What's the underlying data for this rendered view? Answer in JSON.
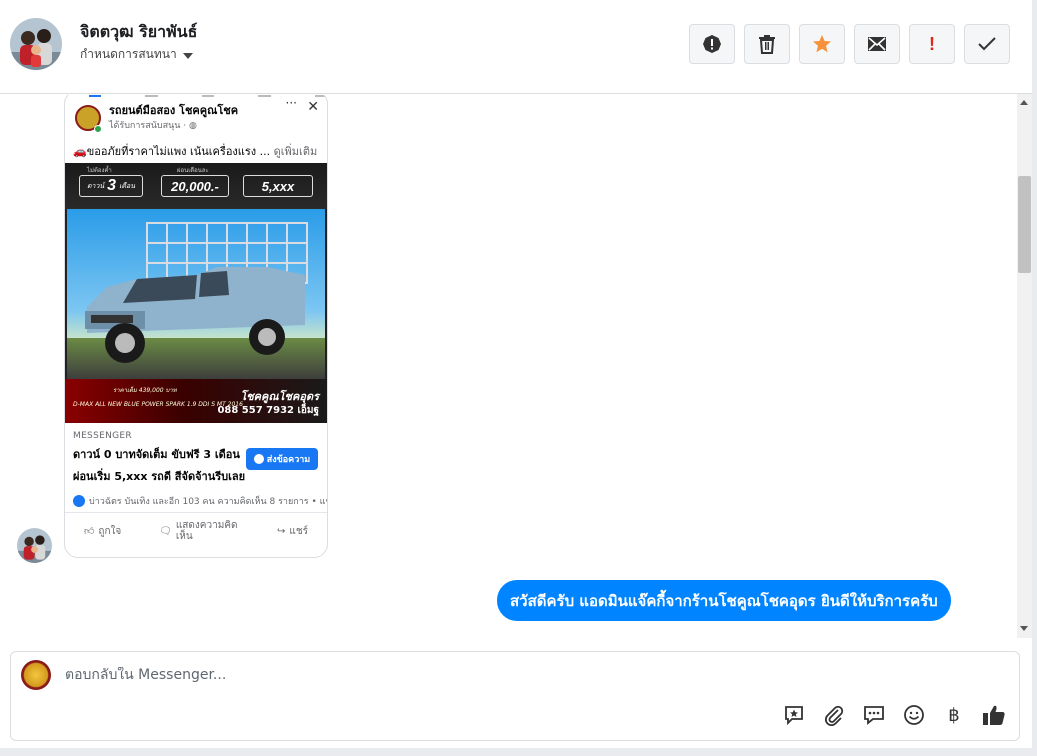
{
  "header": {
    "contact_name": "จิตตวุฒ ริยาพันธ์",
    "subtitle": "กำหนดการสนทนา",
    "actions": [
      {
        "name": "report-spam",
        "icon": "alert-circle-icon"
      },
      {
        "name": "delete",
        "icon": "trash-icon"
      },
      {
        "name": "star",
        "icon": "star-icon",
        "color": "#f7923a"
      },
      {
        "name": "mark-unread",
        "icon": "envelope-icon"
      },
      {
        "name": "mark-important",
        "icon": "exclamation-icon",
        "label": "!",
        "color": "#e0271a"
      },
      {
        "name": "mark-done",
        "icon": "check-icon"
      }
    ]
  },
  "shared_ad": {
    "page_name": "รถยนต์มือสอง โชคคูณโชค",
    "sponsored": "ได้รับการสนับสนุน · ",
    "ad_text": "🚗ขออภัยที่ราคาไม่แพง เน้นเครื่องแรง ...",
    "more": " ดูเพิ่มเติม",
    "image": {
      "box1_prefix": "ดาวน์",
      "box1_value": "3",
      "box1_suffix": "เดือน",
      "box2_value": "20,000.-",
      "box3_value": "5,xxx",
      "top_label_1": "ไม่ต้องค้ำ",
      "top_label_2": "ผ่อนเดือนละ",
      "price_tag": "ราคาเต็ม 439,000 บาท",
      "model": "D-MAX ALL NEW BLUE POWER SPARK 1.9 DDI S MT 2016",
      "brand": "โชคคูณโชคอุดร",
      "phone": "088 557 7932 เอ็มฐ"
    },
    "cta_source": "MESSENGER",
    "cta_line1": "ดาวน์ 0 บาทจัดเต็ม ขับฟรี 3 เดือน",
    "cta_line2": "ผ่อนเริ่ม 5,xxx รถดี สีจัดจ้านรีบเลย",
    "cta_button": "ส่งข้อความ",
    "reactions": "บ่าวฉัตร บันเทิง และอีก 103 คน  ความคิดเห็น 8 รายการ • แชร์",
    "fb_actions": {
      "like": "ถูกใจ",
      "comment": "แสดงความคิดเห็น",
      "share": "แชร์"
    }
  },
  "messages": {
    "outgoing_1": "สวัสดีครับ แอดมินแจ๊คกี้จากร้านโชคูณโชคอุดร ยินดีให้บริการครับ"
  },
  "reply": {
    "placeholder": "ตอบกลับใน Messenger...",
    "tools": [
      "saved-reply-icon",
      "attachment-icon",
      "quick-reply-icon",
      "emoji-icon",
      "payment-icon",
      "thumbs-up-icon"
    ],
    "baht_symbol": "฿"
  },
  "colors": {
    "accent": "#0084ff",
    "fb_blue": "#1877f2",
    "star": "#f7923a",
    "important": "#e0271a"
  }
}
